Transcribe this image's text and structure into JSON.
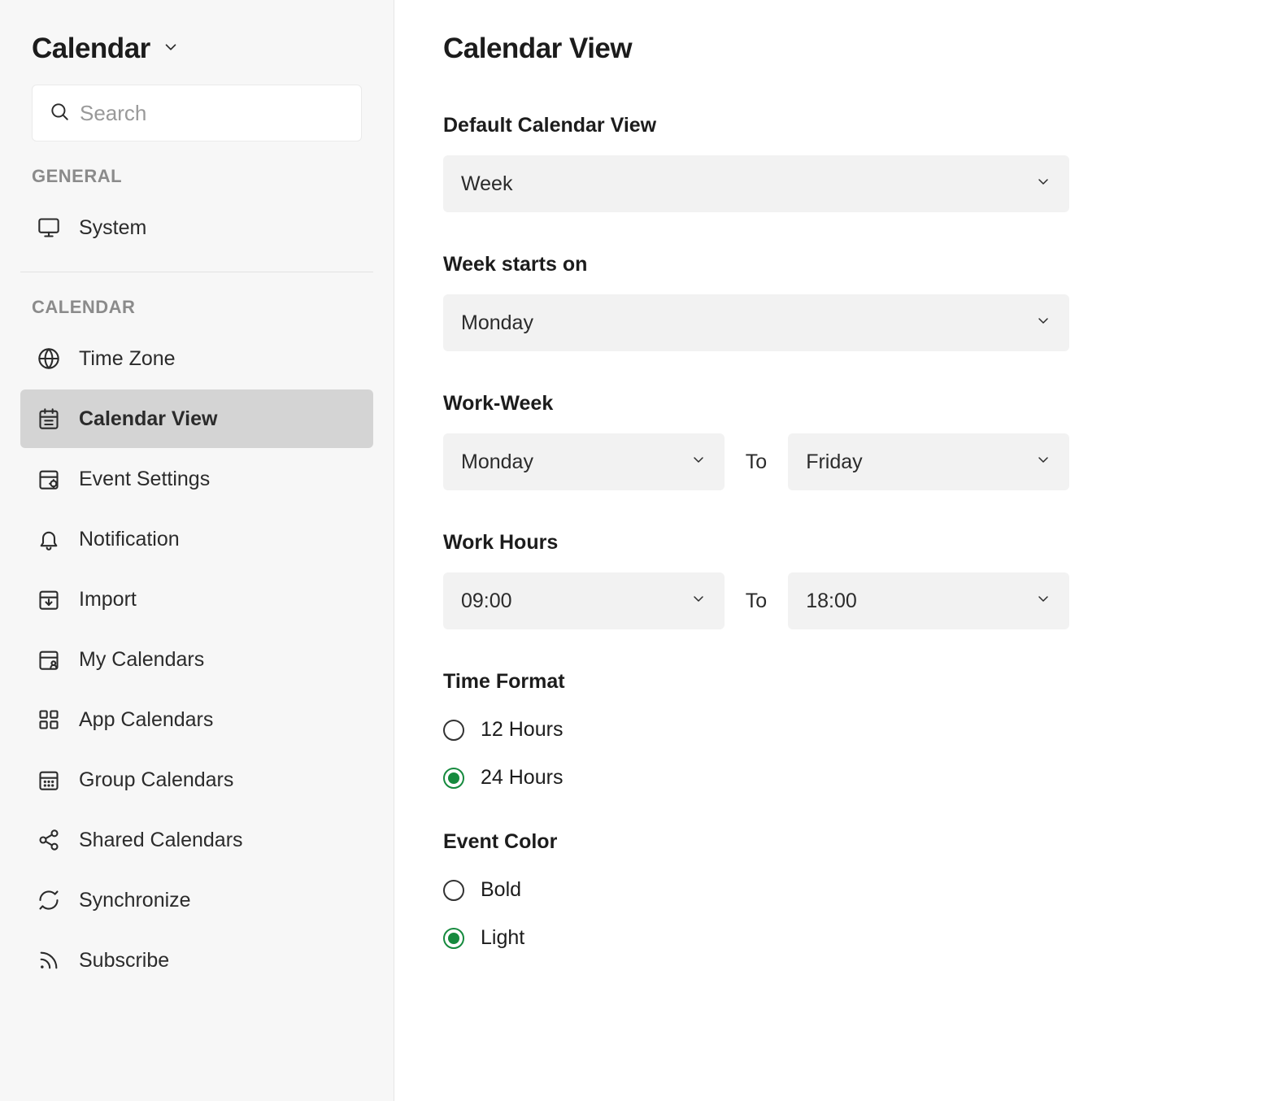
{
  "sidebar": {
    "title": "Calendar",
    "search": {
      "placeholder": "Search"
    },
    "sections": {
      "general": {
        "label": "GENERAL",
        "items": [
          {
            "label": "System"
          }
        ]
      },
      "calendar": {
        "label": "CALENDAR",
        "items": [
          {
            "label": "Time Zone"
          },
          {
            "label": "Calendar View"
          },
          {
            "label": "Event Settings"
          },
          {
            "label": "Notification"
          },
          {
            "label": "Import"
          },
          {
            "label": "My Calendars"
          },
          {
            "label": "App Calendars"
          },
          {
            "label": "Group Calendars"
          },
          {
            "label": "Shared Calendars"
          },
          {
            "label": "Synchronize"
          },
          {
            "label": "Subscribe"
          }
        ]
      }
    }
  },
  "main": {
    "title": "Calendar View",
    "default_view": {
      "label": "Default Calendar View",
      "value": "Week"
    },
    "week_start": {
      "label": "Week starts on",
      "value": "Monday"
    },
    "work_week": {
      "label": "Work-Week",
      "from": "Monday",
      "sep": "To",
      "to": "Friday"
    },
    "work_hours": {
      "label": "Work Hours",
      "from": "09:00",
      "sep": "To",
      "to": "18:00"
    },
    "time_format": {
      "label": "Time Format",
      "options": [
        {
          "label": "12 Hours",
          "selected": false
        },
        {
          "label": "24 Hours",
          "selected": true
        }
      ]
    },
    "event_color": {
      "label": "Event Color",
      "options": [
        {
          "label": "Bold",
          "selected": false
        },
        {
          "label": "Light",
          "selected": true
        }
      ]
    }
  }
}
